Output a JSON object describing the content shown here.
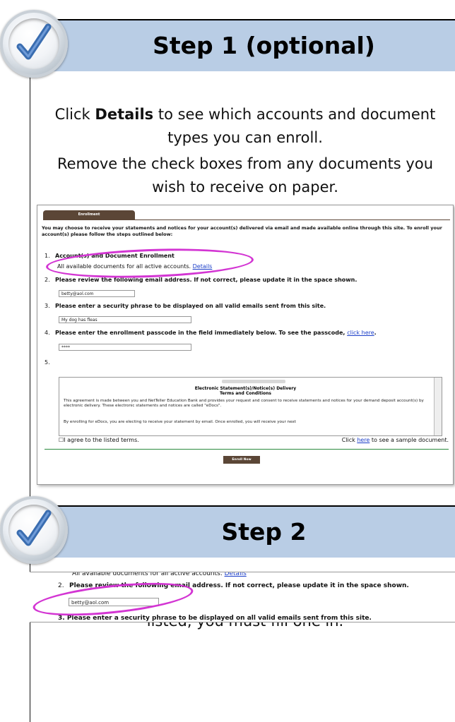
{
  "step1": {
    "title": "Step 1 (optional)",
    "para1_pre": "Click ",
    "para1_bold": "Details",
    "para1_post": " to see which accounts and document types you can enroll.",
    "para2": "Remove the check boxes from any documents you wish to receive on paper."
  },
  "enrollment": {
    "tab_label": "Enrollment",
    "intro": "You may choose to receive your statements and notices for your account(s) delivered via email and made available online through this site. To enroll your account(s) please follow the steps outlined below:",
    "item1_num": "1.",
    "item1": "Account(s) and Document Enrollment",
    "item1_sub": "All available documents for all active accounts. ",
    "details_link": "Details",
    "item2_num": "2.",
    "item2": "Please review the following email address. If not correct, please update it in the space shown.",
    "email_value": "betty@aol.com",
    "item3_num": "3.",
    "item3": "Please enter a security phrase to be displayed on all valid emails sent from this site.",
    "phrase_value": "My dog has fleas",
    "item4_num": "4.",
    "item4_pre": "Please enter the enrollment passcode in the field immediately below. To see the passcode, ",
    "click_here": "click here",
    "item4_post": ".",
    "passcode_value": "****",
    "item5_num": "5.",
    "terms_title1": "Electronic Statement(s)/Notice(s) Delivery",
    "terms_title2": "Terms and Conditions",
    "terms_p1": "This agreement is made between you and NetTeller Education Bank and provides your request and consent to receive statements and notices for your demand deposit account(s) by electronic delivery. These electronic statements and notices are called \"eDocs\".",
    "terms_p2": "By enrolling for eDocs, you are electing to receive your statement by email. Once enrolled, you will receive your next",
    "agree_label": "I agree to the listed terms.",
    "sample_pre": "Click ",
    "sample_link": "here",
    "sample_post": " to see a sample document.",
    "enroll_button": "Enroll Now"
  },
  "step2": {
    "title": "Step 2",
    "para": "Make sure your email address is correct. If no email is listed, you must fill one in.",
    "cut_top": "All available documents for all active accounts. ",
    "details_link": "Details",
    "item2_num": "2.",
    "item2": "Please review the following email address. If not correct, please update it in the space shown.",
    "email_value": "betty@aol.com",
    "cut_bottom": "3.   Please enter a security phrase to be displayed on all valid emails sent from this site."
  },
  "colors": {
    "header_bg": "#b9cde5",
    "accent_oval": "#d335d3",
    "tab_brown": "#5b4636",
    "link": "#1a3dc8"
  },
  "icons": [
    "checkmark-badge-icon",
    "scrollbar-icon",
    "checkbox-icon"
  ]
}
